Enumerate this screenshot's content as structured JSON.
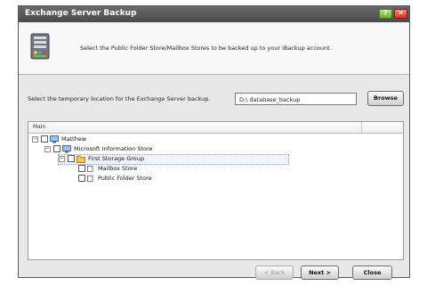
{
  "window": {
    "title": "Exchange Server Backup",
    "help_icon": "help-icon",
    "close_icon": "close-icon"
  },
  "header": {
    "instruction": "Select the Public Folder Store/Mailbox Stores to be backed up to your iBackup account",
    "icon": "server-backup-icon"
  },
  "location": {
    "label": "Select the temporary location for the Exchange Server backup.",
    "path": "D:\\ database_backup",
    "browse_label": "Browse"
  },
  "tree": {
    "column_header": "Main",
    "items": [
      {
        "label": "Matthew",
        "expander": "−",
        "icon": "computer-icon"
      },
      {
        "label": "Microsoft Information Store",
        "expander": "−",
        "icon": "computer-icon"
      },
      {
        "label": "First Storage Group",
        "expander": "−",
        "icon": "folder-icon"
      },
      {
        "label": "Mailbox Store",
        "icon": "document-icon"
      },
      {
        "label": "Public Folder Store",
        "icon": "document-icon"
      }
    ]
  },
  "buttons": {
    "back": "< Back",
    "next": "Next >",
    "close": "Close"
  },
  "colors": {
    "titlebar": "#4f4f4f",
    "window_bg": "#e8e8e8",
    "selection_outline": "#8a94c8"
  }
}
